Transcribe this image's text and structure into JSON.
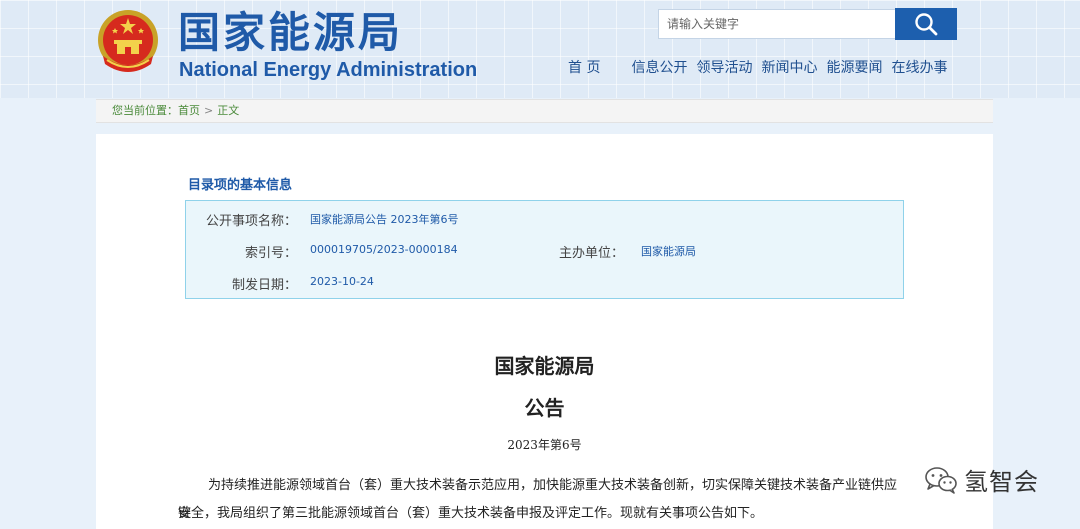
{
  "header": {
    "logo_cn": "国家能源局",
    "logo_en": "National Energy Administration"
  },
  "search": {
    "placeholder": "请输入关键字",
    "button_icon": "search-icon"
  },
  "nav": {
    "items": [
      "首 页",
      "信息公开",
      "领导活动",
      "新闻中心",
      "能源要闻",
      "在线办事"
    ]
  },
  "breadcrumb": {
    "prefix": "您当前位置：",
    "home": "首页",
    "separator": ">",
    "current": "正文"
  },
  "catalog": {
    "title": "目录项的基本信息",
    "name_label": "公开事项名称：",
    "name_value": "国家能源局公告 2023年第6号",
    "index_label": "索引号：",
    "index_value": "000019705/2023-0000184",
    "org_label": "主办单位：",
    "org_value": "国家能源局",
    "date_label": "制发日期：",
    "date_value": "2023-10-24"
  },
  "document": {
    "issuer": "国家能源局",
    "type": "公告",
    "number": "2023年第6号",
    "paragraph_line1": "为持续推进能源领域首台（套）重大技术装备示范应用，加快能源重大技术装备创新，切实保障关键技术装备产业链供应链",
    "paragraph_line2": "安全，我局组织了第三批能源领域首台（套）重大技术装备申报及评定工作。现就有关事项公告如下。"
  },
  "watermark": {
    "icon": "wechat-icon",
    "text": "氢智会"
  },
  "colors": {
    "brand_blue": "#1f5aa8",
    "search_button": "#1d5fae",
    "breadcrumb_green": "#4a8a3a",
    "info_box_bg": "#eaf6fb",
    "info_box_border": "#8fd2ea"
  }
}
